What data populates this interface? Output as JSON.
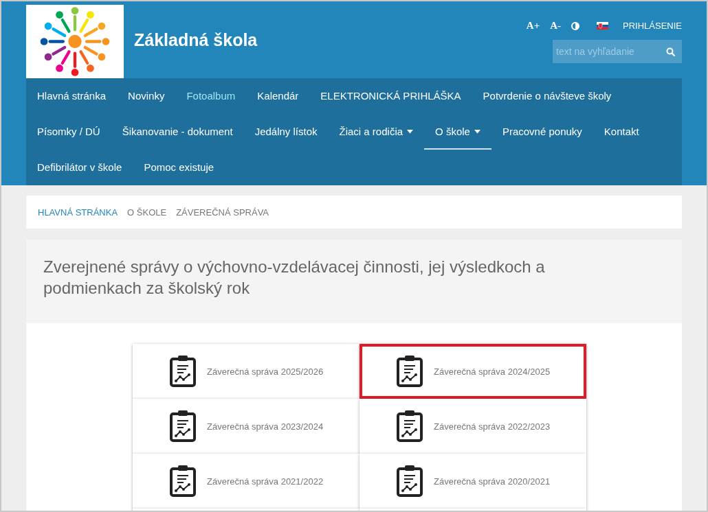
{
  "site": {
    "title": "Základná škola"
  },
  "tools": {
    "font_larger": "A+",
    "font_smaller": "A-",
    "login": "PRIHLÁSENIE"
  },
  "search": {
    "placeholder": "text na vyhľadanie"
  },
  "nav": [
    {
      "label": "Hlavná stránka",
      "selected": false,
      "highlighted": false,
      "dropdown": false
    },
    {
      "label": "Novinky",
      "selected": false,
      "highlighted": false,
      "dropdown": false
    },
    {
      "label": "Fotoalbum",
      "selected": false,
      "highlighted": true,
      "dropdown": false
    },
    {
      "label": "Kalendár",
      "selected": false,
      "highlighted": false,
      "dropdown": false
    },
    {
      "label": "ELEKTRONICKÁ PRIHLÁŠKA",
      "selected": false,
      "highlighted": false,
      "dropdown": false
    },
    {
      "label": "Potvrdenie o návšteve školy",
      "selected": false,
      "highlighted": false,
      "dropdown": false
    },
    {
      "label": "Písomky / DÚ",
      "selected": false,
      "highlighted": false,
      "dropdown": false
    },
    {
      "label": "Šikanovanie - dokument",
      "selected": false,
      "highlighted": false,
      "dropdown": false
    },
    {
      "label": "Jedálny lístok",
      "selected": false,
      "highlighted": false,
      "dropdown": false
    },
    {
      "label": "Žiaci a rodičia",
      "selected": false,
      "highlighted": false,
      "dropdown": true
    },
    {
      "label": "O škole",
      "selected": true,
      "highlighted": false,
      "dropdown": true
    },
    {
      "label": "Pracovné ponuky",
      "selected": false,
      "highlighted": false,
      "dropdown": false
    },
    {
      "label": "Kontakt",
      "selected": false,
      "highlighted": false,
      "dropdown": false
    },
    {
      "label": "Defibrilátor v škole",
      "selected": false,
      "highlighted": false,
      "dropdown": false
    },
    {
      "label": "Pomoc existuje",
      "selected": false,
      "highlighted": false,
      "dropdown": false
    }
  ],
  "breadcrumb": [
    {
      "label": "HLAVNÁ STRÁNKA",
      "link": true
    },
    {
      "label": "O ŠKOLE",
      "link": false
    },
    {
      "label": "ZÁVEREČNÁ SPRÁVA",
      "link": false
    }
  ],
  "page_title": "Zverejnené správy o výchovno-vzdelávacej činnosti, jej výsledkoch a podmienkach za školský rok",
  "reports": [
    {
      "label": "Záverečná správa 2025/2026",
      "highlighted": false
    },
    {
      "label": "Záverečná správa 2024/2025",
      "highlighted": true
    },
    {
      "label": "Záverečná správa 2023/2024",
      "highlighted": false
    },
    {
      "label": "Záverečná správa 2022/2023",
      "highlighted": false
    },
    {
      "label": "Záverečná správa 2021/2022",
      "highlighted": false
    },
    {
      "label": "Záverečná správa 2020/2021",
      "highlighted": false
    }
  ]
}
